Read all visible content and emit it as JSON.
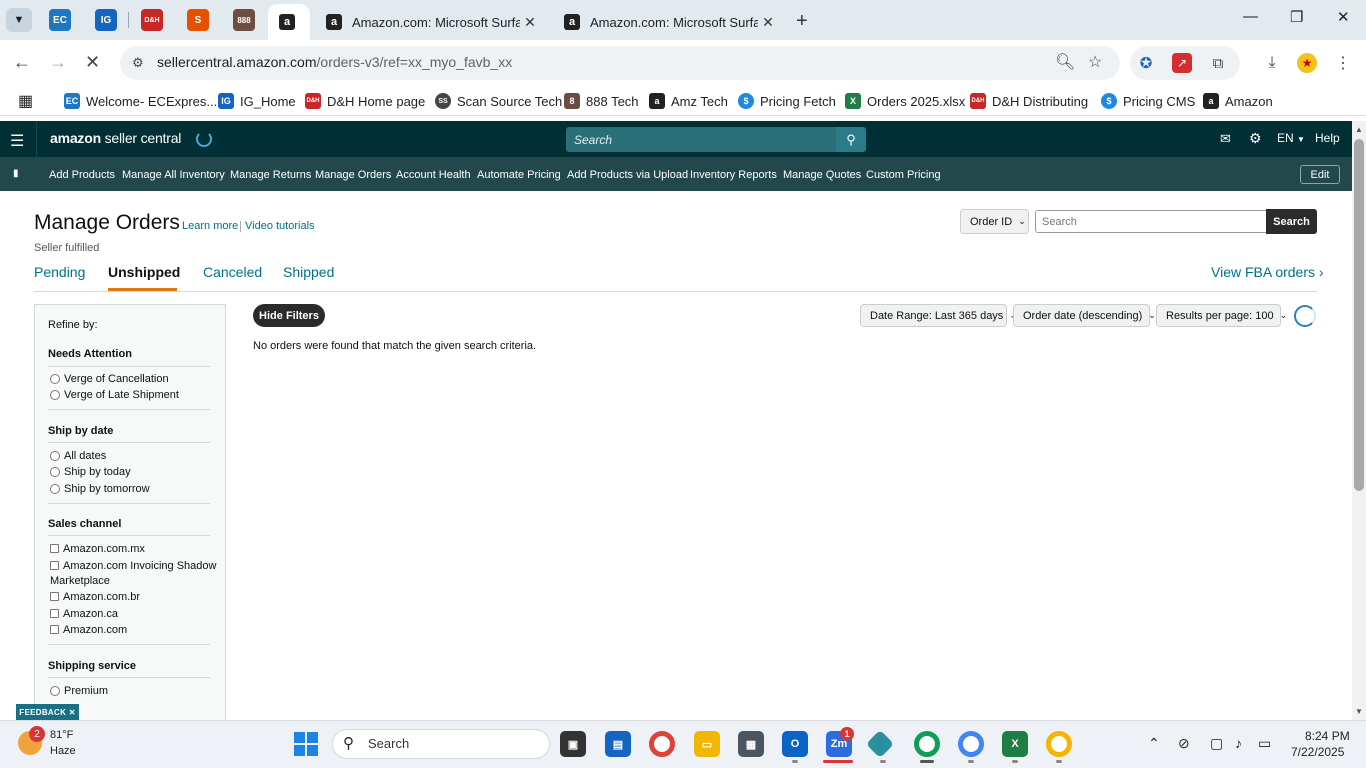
{
  "browser": {
    "tabs": [
      {
        "title": "Amazon.com: Microsoft Surface",
        "active": true
      },
      {
        "title": "Amazon.com: Microsoft Surface",
        "active": false
      }
    ],
    "pinned": [
      {
        "label": "EC",
        "color": "#1d77c2"
      },
      {
        "label": "IG",
        "color": "#1565c0"
      },
      {
        "label": "D&H",
        "color": "#c62828"
      },
      {
        "label": "S",
        "color": "#e65100"
      },
      {
        "label": "888",
        "color": "#6d4c41"
      },
      {
        "label": "a",
        "color": "#222222"
      }
    ],
    "url_host": "sellercentral.amazon.com",
    "url_path": "/orders-v3/ref=xx_myo_favb_xx",
    "bookmarks": [
      {
        "label": "Welcome- ECExpres...",
        "icon": "EC",
        "color": "#1d77c2"
      },
      {
        "label": "IG_Home",
        "icon": "IG",
        "color": "#1565c0"
      },
      {
        "label": "D&H Home page",
        "icon": "D&H",
        "color": "#c62828"
      },
      {
        "label": "Scan Source Tech",
        "icon": "SS",
        "color": "#444444"
      },
      {
        "label": "888 Tech",
        "icon": "8",
        "color": "#6d4c41"
      },
      {
        "label": "Amz Tech",
        "icon": "a",
        "color": "#222222"
      },
      {
        "label": "Pricing Fetch",
        "icon": "$",
        "color": "#1e88e5"
      },
      {
        "label": "Orders 2025.xlsx",
        "icon": "X",
        "color": "#1e7e45"
      },
      {
        "label": "D&H Distributing",
        "icon": "D&H",
        "color": "#c62828"
      },
      {
        "label": "Pricing CMS",
        "icon": "$",
        "color": "#1e88e5"
      },
      {
        "label": "Amazon",
        "icon": "a",
        "color": "#222222"
      }
    ]
  },
  "seller_header": {
    "logo_bold": "amazon",
    "logo_thin": " seller central",
    "search_placeholder": "Search",
    "lang": "EN",
    "help": "Help"
  },
  "nav": {
    "items": [
      "Add Products",
      "Manage All Inventory",
      "Manage Returns",
      "Manage Orders",
      "Account Health",
      "Automate Pricing",
      "Add Products via Upload",
      "Inventory Reports",
      "Manage Quotes",
      "Custom Pricing"
    ],
    "edit": "Edit"
  },
  "page": {
    "title": "Manage Orders",
    "learn_more": "Learn more",
    "video_tutorials": "Video tutorials",
    "subtitle": "Seller fulfilled",
    "id_select": "Order ID",
    "search_placeholder": "Search",
    "search_button": "Search",
    "tabs": [
      "Pending",
      "Unshipped",
      "Canceled",
      "Shipped"
    ],
    "active_tab": "Unshipped",
    "fba_link": "View FBA orders ›"
  },
  "filters": {
    "refine_by": "Refine by:",
    "needs_attention": {
      "title": "Needs Attention",
      "options": [
        "Verge of Cancellation",
        "Verge of Late Shipment"
      ]
    },
    "ship_by_date": {
      "title": "Ship by date",
      "options": [
        "All dates",
        "Ship by today",
        "Ship by tomorrow"
      ]
    },
    "sales_channel": {
      "title": "Sales channel",
      "options": [
        "Amazon.com.mx",
        "Amazon.com Invoicing Shadow",
        "Marketplace",
        "Amazon.com.br",
        "Amazon.ca",
        "Amazon.com"
      ]
    },
    "shipping_service": {
      "title": "Shipping service",
      "options": [
        "Premium"
      ]
    }
  },
  "results": {
    "hide_filters": "Hide Filters",
    "empty_message": "No orders were found that match the given search criteria.",
    "date_range": "Date Range: Last 365 days",
    "sort": "Order date (descending)",
    "per_page": "Results per page: 100"
  },
  "feedback": "FEEDBACK",
  "taskbar": {
    "weather_temp": "81°F",
    "weather_cond": "Haze",
    "weather_badge": "2",
    "search": "Search",
    "zoom_badge": "1",
    "time": "8:24 PM",
    "date": "7/22/2025"
  }
}
